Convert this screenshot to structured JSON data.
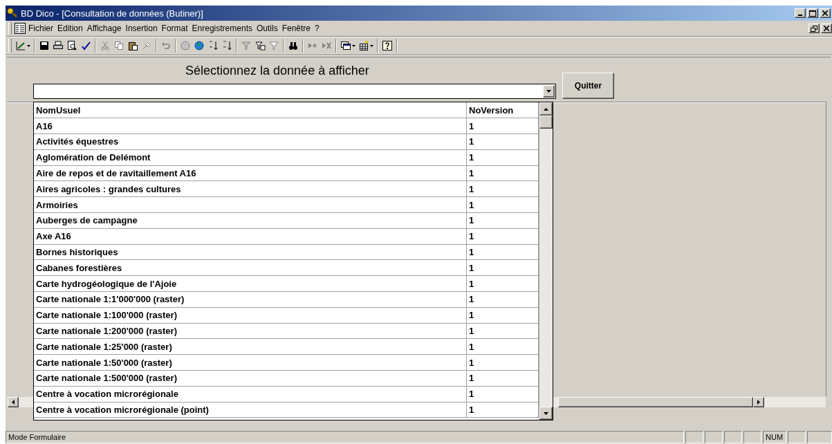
{
  "window": {
    "title": "BD Dico - [Consultation de données (Butiner)]"
  },
  "menu": [
    "Fichier",
    "Edition",
    "Affichage",
    "Insertion",
    "Format",
    "Enregistrements",
    "Outils",
    "Fenêtre",
    "?"
  ],
  "form": {
    "heading": "Sélectionnez la donnée à afficher",
    "quit_button": "Quitter"
  },
  "dropdown": {
    "columns": [
      "NomUsuel",
      "NoVersion"
    ],
    "rows": [
      [
        "A16",
        "1"
      ],
      [
        "Activités équestres",
        "1"
      ],
      [
        "Aglomération de Delémont",
        "1"
      ],
      [
        "Aire de repos et de ravitaillement A16",
        "1"
      ],
      [
        "Aires agricoles : grandes cultures",
        "1"
      ],
      [
        "Armoiries",
        "1"
      ],
      [
        "Auberges de campagne",
        "1"
      ],
      [
        "Axe A16",
        "1"
      ],
      [
        "Bornes historiques",
        "1"
      ],
      [
        "Cabanes forestières",
        "1"
      ],
      [
        "Carte hydrogéologique de l'Ajoie",
        "1"
      ],
      [
        "Carte nationale 1:1'000'000 (raster)",
        "1"
      ],
      [
        "Carte nationale 1:100'000 (raster)",
        "1"
      ],
      [
        "Carte nationale 1:200'000 (raster)",
        "1"
      ],
      [
        "Carte nationale 1:25'000 (raster)",
        "1"
      ],
      [
        "Carte nationale 1:50'000 (raster)",
        "1"
      ],
      [
        "Carte nationale 1:500'000 (raster)",
        "1"
      ],
      [
        "Centre à vocation microrégionale",
        "1"
      ],
      [
        "Centre à vocation microrégionale (point)",
        "1"
      ]
    ]
  },
  "status_bar": {
    "mode": "Mode Formulaire",
    "num": "NUM"
  }
}
